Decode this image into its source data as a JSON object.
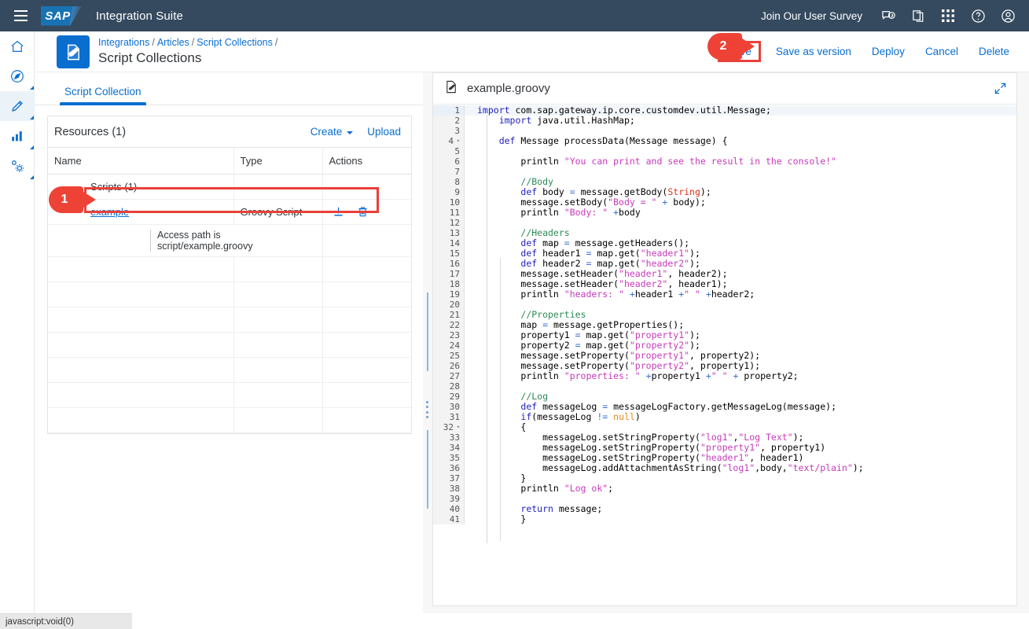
{
  "shell": {
    "menu_icon": "hamburger-icon",
    "logo_text": "SAP",
    "app_title": "Integration Suite",
    "survey_link": "Join Our User Survey",
    "icons": [
      "feedback-icon",
      "copy-icon",
      "grid-apps-icon",
      "help-icon",
      "user-account-icon"
    ]
  },
  "rail": {
    "items": [
      {
        "name": "home-icon",
        "active": false
      },
      {
        "name": "discover-compass-icon",
        "active": false
      },
      {
        "name": "design-pencil-icon",
        "active": true
      },
      {
        "name": "monitor-chart-icon",
        "active": false
      },
      {
        "name": "settings-gear-icon",
        "active": false
      }
    ]
  },
  "object_header": {
    "icon": "script-edit-icon",
    "breadcrumb": [
      "Integrations",
      "Articles",
      "Script Collections"
    ],
    "breadcrumb_separator": "/",
    "title": "Script Collections",
    "actions": [
      {
        "label": "Save",
        "highlighted": true
      },
      {
        "label": "Save as version",
        "highlighted": false
      },
      {
        "label": "Deploy",
        "highlighted": false
      },
      {
        "label": "Cancel",
        "highlighted": false
      },
      {
        "label": "Delete",
        "highlighted": false
      }
    ]
  },
  "callouts": [
    {
      "number": "1"
    },
    {
      "number": "2"
    }
  ],
  "left_panel": {
    "tabs": [
      {
        "label": "Script Collection",
        "active": true
      }
    ],
    "table": {
      "title": "Resources (1)",
      "create_label": "Create",
      "upload_label": "Upload",
      "columns": [
        "Name",
        "Type",
        "Actions"
      ],
      "group": {
        "caret": "⌄",
        "label": "Scripts (1)"
      },
      "rows": [
        {
          "name": "example",
          "type": "Groovy Script",
          "actions": [
            "download-icon",
            "delete-icon"
          ],
          "highlighted": true
        }
      ],
      "access_path": "Access path is script/example.groovy",
      "empty_rows": 7
    }
  },
  "editor": {
    "title": "example.groovy",
    "file_icon": "edit-document-icon",
    "expand_icon": "fullscreen-icon",
    "code_lines": [
      {
        "n": 1,
        "fold": false,
        "indent": 0,
        "tokens": [
          {
            "t": "import",
            "c": "kw"
          },
          {
            "t": " com.sap.gateway.ip.core.customdev.util.Message;",
            "c": ""
          }
        ]
      },
      {
        "n": 2,
        "fold": false,
        "indent": 1,
        "tokens": [
          {
            "t": "import",
            "c": "kw"
          },
          {
            "t": " java.util.HashMap;",
            "c": ""
          }
        ]
      },
      {
        "n": 3,
        "fold": false,
        "indent": 1,
        "tokens": []
      },
      {
        "n": 4,
        "fold": true,
        "indent": 1,
        "tokens": [
          {
            "t": "def",
            "c": "kw"
          },
          {
            "t": " Message processData(Message message) {",
            "c": ""
          }
        ]
      },
      {
        "n": 5,
        "fold": false,
        "indent": 1,
        "tokens": []
      },
      {
        "n": 6,
        "fold": false,
        "indent": 2,
        "tokens": [
          {
            "t": "println ",
            "c": ""
          },
          {
            "t": "\"You can print and see the result in the console!\"",
            "c": "str"
          }
        ]
      },
      {
        "n": 7,
        "fold": false,
        "indent": 1,
        "tokens": []
      },
      {
        "n": 8,
        "fold": false,
        "indent": 2,
        "tokens": [
          {
            "t": "//Body",
            "c": "cmt"
          }
        ]
      },
      {
        "n": 9,
        "fold": false,
        "indent": 2,
        "tokens": [
          {
            "t": "def",
            "c": "kw"
          },
          {
            "t": " body ",
            "c": ""
          },
          {
            "t": "=",
            "c": "op"
          },
          {
            "t": " message.getBody(",
            "c": ""
          },
          {
            "t": "String",
            "c": "typ"
          },
          {
            "t": ");",
            "c": ""
          }
        ]
      },
      {
        "n": 10,
        "fold": false,
        "indent": 2,
        "tokens": [
          {
            "t": "message.setBody(",
            "c": ""
          },
          {
            "t": "\"Body = \"",
            "c": "str"
          },
          {
            "t": " ",
            "c": ""
          },
          {
            "t": "+",
            "c": "op"
          },
          {
            "t": " body);",
            "c": ""
          }
        ]
      },
      {
        "n": 11,
        "fold": false,
        "indent": 2,
        "tokens": [
          {
            "t": "println ",
            "c": ""
          },
          {
            "t": "\"Body: \"",
            "c": "str"
          },
          {
            "t": " ",
            "c": ""
          },
          {
            "t": "+",
            "c": "op"
          },
          {
            "t": "body",
            "c": ""
          }
        ]
      },
      {
        "n": 12,
        "fold": false,
        "indent": 1,
        "tokens": []
      },
      {
        "n": 13,
        "fold": false,
        "indent": 2,
        "tokens": [
          {
            "t": "//Headers",
            "c": "cmt"
          }
        ]
      },
      {
        "n": 14,
        "fold": false,
        "indent": 2,
        "tokens": [
          {
            "t": "def",
            "c": "kw"
          },
          {
            "t": " map ",
            "c": ""
          },
          {
            "t": "=",
            "c": "op"
          },
          {
            "t": " message.getHeaders();",
            "c": ""
          }
        ]
      },
      {
        "n": 15,
        "fold": false,
        "indent": 2,
        "tokens": [
          {
            "t": "def",
            "c": "kw"
          },
          {
            "t": " header1 ",
            "c": ""
          },
          {
            "t": "=",
            "c": "op"
          },
          {
            "t": " map.get(",
            "c": ""
          },
          {
            "t": "\"header1\"",
            "c": "str"
          },
          {
            "t": ");",
            "c": ""
          }
        ]
      },
      {
        "n": 16,
        "fold": false,
        "indent": 2,
        "tokens": [
          {
            "t": "def",
            "c": "kw"
          },
          {
            "t": " header2 ",
            "c": ""
          },
          {
            "t": "=",
            "c": "op"
          },
          {
            "t": " map.get(",
            "c": ""
          },
          {
            "t": "\"header2\"",
            "c": "str"
          },
          {
            "t": ");",
            "c": ""
          }
        ]
      },
      {
        "n": 17,
        "fold": false,
        "indent": 2,
        "tokens": [
          {
            "t": "message.setHeader(",
            "c": ""
          },
          {
            "t": "\"header1\"",
            "c": "str"
          },
          {
            "t": ", header2);",
            "c": ""
          }
        ]
      },
      {
        "n": 18,
        "fold": false,
        "indent": 2,
        "tokens": [
          {
            "t": "message.setHeader(",
            "c": ""
          },
          {
            "t": "\"header2\"",
            "c": "str"
          },
          {
            "t": ", header1);",
            "c": ""
          }
        ]
      },
      {
        "n": 19,
        "fold": false,
        "indent": 2,
        "tokens": [
          {
            "t": "println ",
            "c": ""
          },
          {
            "t": "\"headers: \"",
            "c": "str"
          },
          {
            "t": " ",
            "c": ""
          },
          {
            "t": "+",
            "c": "op"
          },
          {
            "t": "header1 ",
            "c": ""
          },
          {
            "t": "+",
            "c": "op"
          },
          {
            "t": "\" \"",
            "c": "str"
          },
          {
            "t": " ",
            "c": ""
          },
          {
            "t": "+",
            "c": "op"
          },
          {
            "t": "header2;",
            "c": ""
          }
        ]
      },
      {
        "n": 20,
        "fold": false,
        "indent": 1,
        "tokens": []
      },
      {
        "n": 21,
        "fold": false,
        "indent": 2,
        "tokens": [
          {
            "t": "//Properties",
            "c": "cmt"
          }
        ]
      },
      {
        "n": 22,
        "fold": false,
        "indent": 2,
        "tokens": [
          {
            "t": "map ",
            "c": ""
          },
          {
            "t": "=",
            "c": "op"
          },
          {
            "t": " message.getProperties();",
            "c": ""
          }
        ]
      },
      {
        "n": 23,
        "fold": false,
        "indent": 2,
        "tokens": [
          {
            "t": "property1 ",
            "c": ""
          },
          {
            "t": "=",
            "c": "op"
          },
          {
            "t": " map.get(",
            "c": ""
          },
          {
            "t": "\"property1\"",
            "c": "str"
          },
          {
            "t": ");",
            "c": ""
          }
        ]
      },
      {
        "n": 24,
        "fold": false,
        "indent": 2,
        "tokens": [
          {
            "t": "property2 ",
            "c": ""
          },
          {
            "t": "=",
            "c": "op"
          },
          {
            "t": " map.get(",
            "c": ""
          },
          {
            "t": "\"property2\"",
            "c": "str"
          },
          {
            "t": ");",
            "c": ""
          }
        ]
      },
      {
        "n": 25,
        "fold": false,
        "indent": 2,
        "tokens": [
          {
            "t": "message.setProperty(",
            "c": ""
          },
          {
            "t": "\"property1\"",
            "c": "str"
          },
          {
            "t": ", property2);",
            "c": ""
          }
        ]
      },
      {
        "n": 26,
        "fold": false,
        "indent": 2,
        "tokens": [
          {
            "t": "message.setProperty(",
            "c": ""
          },
          {
            "t": "\"property2\"",
            "c": "str"
          },
          {
            "t": ", property1);",
            "c": ""
          }
        ]
      },
      {
        "n": 27,
        "fold": false,
        "indent": 2,
        "tokens": [
          {
            "t": "println ",
            "c": ""
          },
          {
            "t": "\"properties: \"",
            "c": "str"
          },
          {
            "t": " ",
            "c": ""
          },
          {
            "t": "+",
            "c": "op"
          },
          {
            "t": "property1 ",
            "c": ""
          },
          {
            "t": "+",
            "c": "op"
          },
          {
            "t": "\" \"",
            "c": "str"
          },
          {
            "t": " ",
            "c": ""
          },
          {
            "t": "+",
            "c": "op"
          },
          {
            "t": " property2;",
            "c": ""
          }
        ]
      },
      {
        "n": 28,
        "fold": false,
        "indent": 1,
        "tokens": []
      },
      {
        "n": 29,
        "fold": false,
        "indent": 2,
        "tokens": [
          {
            "t": "//Log",
            "c": "cmt"
          }
        ]
      },
      {
        "n": 30,
        "fold": false,
        "indent": 2,
        "tokens": [
          {
            "t": "def",
            "c": "kw"
          },
          {
            "t": " messageLog ",
            "c": ""
          },
          {
            "t": "=",
            "c": "op"
          },
          {
            "t": " messageLogFactory.getMessageLog(message);",
            "c": ""
          }
        ]
      },
      {
        "n": 31,
        "fold": false,
        "indent": 2,
        "tokens": [
          {
            "t": "if",
            "c": "kw"
          },
          {
            "t": "(messageLog ",
            "c": ""
          },
          {
            "t": "!=",
            "c": "op"
          },
          {
            "t": " ",
            "c": ""
          },
          {
            "t": "null",
            "c": "nul"
          },
          {
            "t": ")",
            "c": ""
          }
        ]
      },
      {
        "n": 32,
        "fold": true,
        "indent": 2,
        "tokens": [
          {
            "t": "{",
            "c": ""
          }
        ]
      },
      {
        "n": 33,
        "fold": false,
        "indent": 3,
        "tokens": [
          {
            "t": "messageLog.setStringProperty(",
            "c": ""
          },
          {
            "t": "\"log1\"",
            "c": "str"
          },
          {
            "t": ",",
            "c": ""
          },
          {
            "t": "\"Log Text\"",
            "c": "str"
          },
          {
            "t": ");",
            "c": ""
          }
        ]
      },
      {
        "n": 34,
        "fold": false,
        "indent": 3,
        "tokens": [
          {
            "t": "messageLog.setStringProperty(",
            "c": ""
          },
          {
            "t": "\"property1\"",
            "c": "str"
          },
          {
            "t": ", property1)",
            "c": ""
          }
        ]
      },
      {
        "n": 35,
        "fold": false,
        "indent": 3,
        "tokens": [
          {
            "t": "messageLog.setStringProperty(",
            "c": ""
          },
          {
            "t": "\"header1\"",
            "c": "str"
          },
          {
            "t": ", header1)",
            "c": ""
          }
        ]
      },
      {
        "n": 36,
        "fold": false,
        "indent": 3,
        "tokens": [
          {
            "t": "messageLog.addAttachmentAsString(",
            "c": ""
          },
          {
            "t": "\"log1\"",
            "c": "str"
          },
          {
            "t": ",body,",
            "c": ""
          },
          {
            "t": "\"text/plain\"",
            "c": "str"
          },
          {
            "t": ");",
            "c": ""
          }
        ]
      },
      {
        "n": 37,
        "fold": false,
        "indent": 2,
        "tokens": [
          {
            "t": "}",
            "c": ""
          }
        ]
      },
      {
        "n": 38,
        "fold": false,
        "indent": 2,
        "tokens": [
          {
            "t": "println ",
            "c": ""
          },
          {
            "t": "\"Log ok\"",
            "c": "str"
          },
          {
            "t": ";",
            "c": ""
          }
        ]
      },
      {
        "n": 39,
        "fold": false,
        "indent": 1,
        "tokens": []
      },
      {
        "n": 40,
        "fold": false,
        "indent": 2,
        "tokens": [
          {
            "t": "return",
            "c": "kw"
          },
          {
            "t": " message;",
            "c": ""
          }
        ]
      },
      {
        "n": 41,
        "fold": false,
        "indent": 2,
        "tokens": [
          {
            "t": "}",
            "c": ""
          }
        ]
      }
    ]
  },
  "status_bar": {
    "text": "javascript:void(0)"
  },
  "colors": {
    "shell_bg": "#354a5f",
    "accent_blue": "#0a6ed1",
    "highlight_red": "#e8413a",
    "callout_red": "#ef4237",
    "page_bg": "#f7f7f7"
  }
}
